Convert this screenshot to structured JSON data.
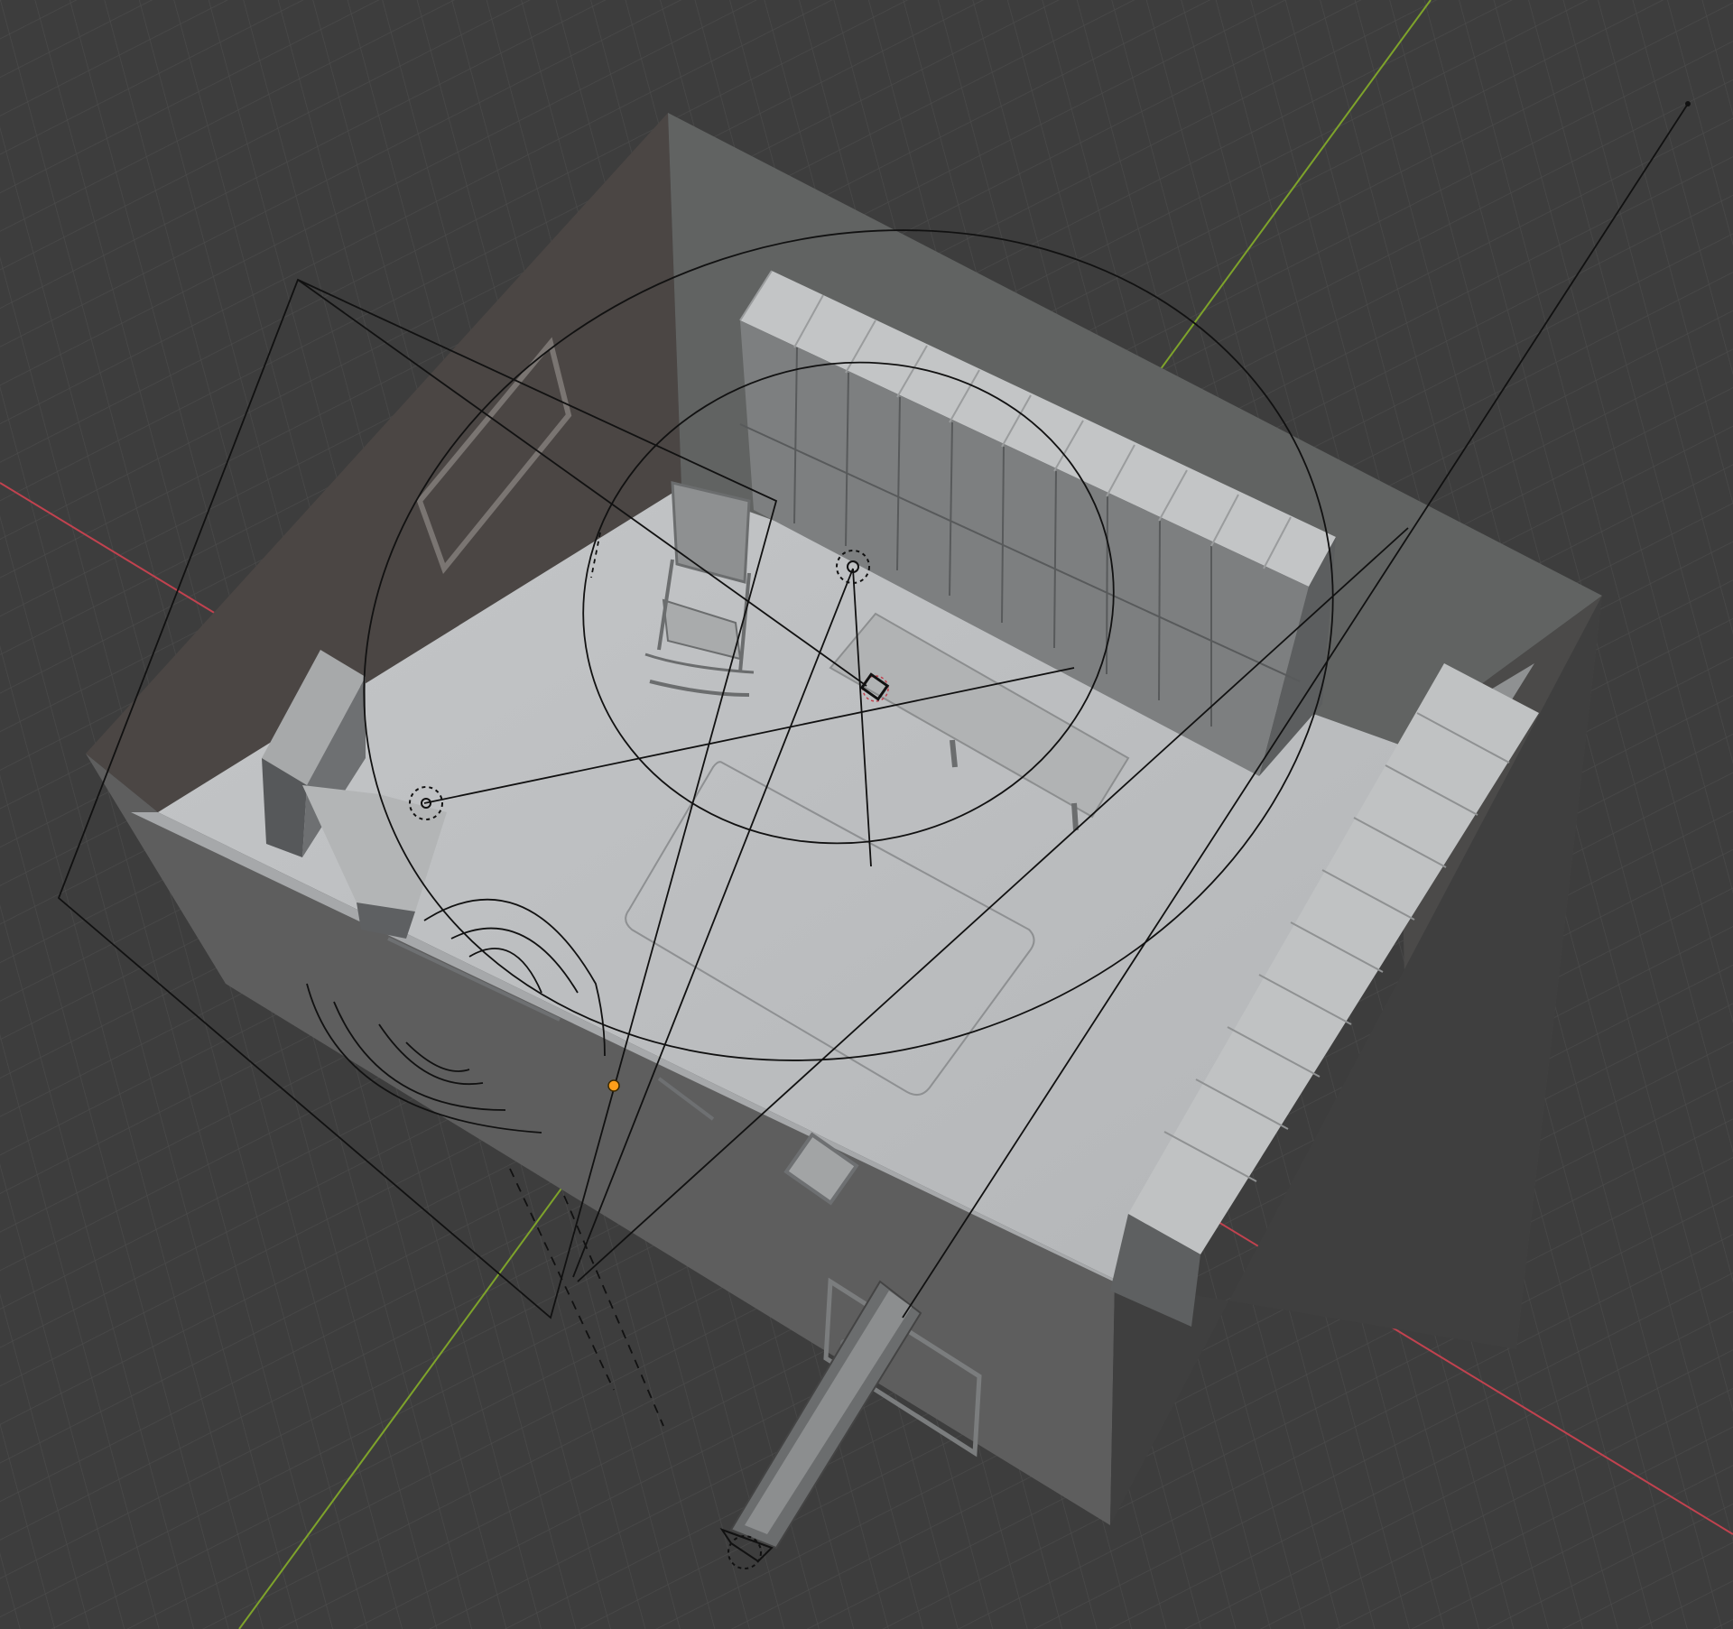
{
  "app": {
    "title": ""
  },
  "viewport": {
    "mode": "3d-viewport-solid",
    "background": "#3d3d3d",
    "grid_color": "#4a4a4a",
    "x_axis_color": "#c1424f",
    "y_axis_color": "#7ea32b",
    "wire_color": "#111111",
    "selected_origin_color": "#ff9f1a"
  },
  "scene": {
    "objects": [
      {
        "name": "room-walls",
        "icon": "mesh-icon"
      },
      {
        "name": "floor",
        "icon": "mesh-icon"
      },
      {
        "name": "locker-row-back",
        "icon": "mesh-icon",
        "count": 10
      },
      {
        "name": "locker-row-right",
        "icon": "mesh-icon",
        "count": 10
      },
      {
        "name": "rocking-chair",
        "icon": "mesh-icon"
      },
      {
        "name": "bench",
        "icon": "mesh-icon"
      },
      {
        "name": "floor-rug",
        "icon": "mesh-icon"
      },
      {
        "name": "cabinet",
        "icon": "mesh-icon"
      },
      {
        "name": "wall-frame",
        "icon": "mesh-icon"
      },
      {
        "name": "door",
        "icon": "mesh-icon"
      },
      {
        "name": "area-light",
        "icon": "light-icon"
      },
      {
        "name": "point-light-1",
        "icon": "light-icon"
      },
      {
        "name": "point-light-2",
        "icon": "light-icon"
      },
      {
        "name": "spot-light",
        "icon": "light-icon"
      },
      {
        "name": "camera",
        "icon": "camera-icon"
      }
    ]
  }
}
